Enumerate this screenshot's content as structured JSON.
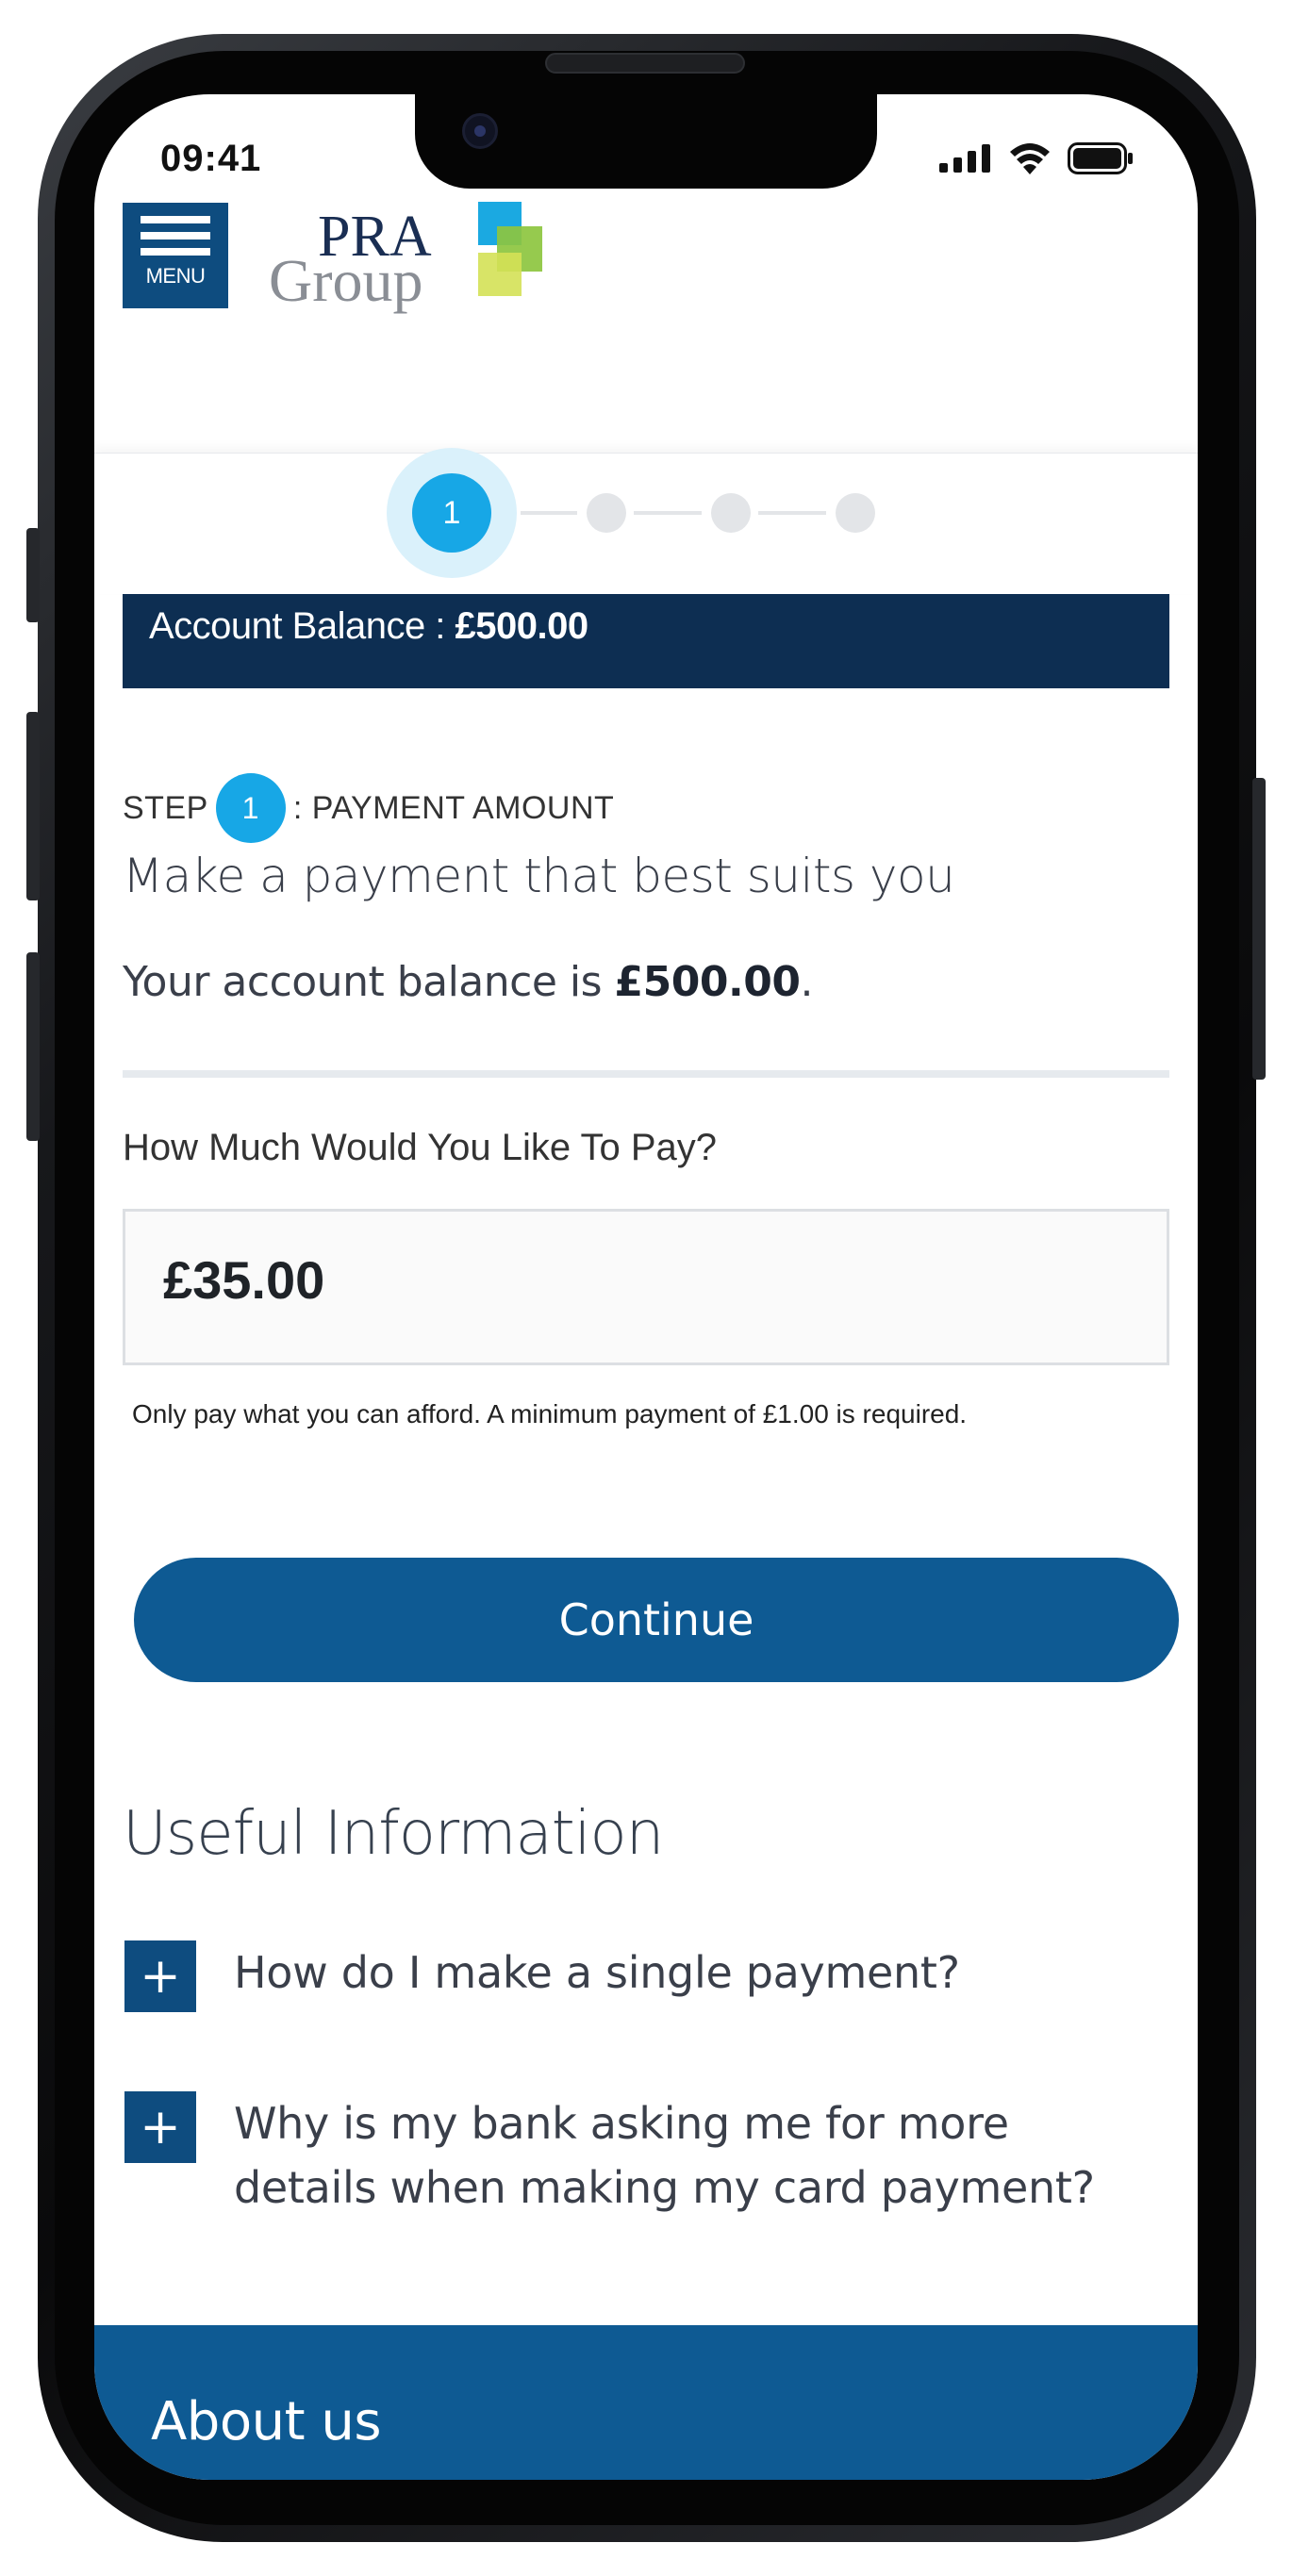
{
  "status_bar": {
    "time": "09:41",
    "signal_icon": "cellular-signal-icon",
    "wifi_icon": "wifi-icon",
    "battery_icon": "battery-icon"
  },
  "header": {
    "menu_label": "MENU",
    "logo_line1": "PRA",
    "logo_line2": "Group",
    "logo_colors": [
      "#1ba9e1",
      "#8dc63f",
      "#c9da4a"
    ]
  },
  "stepper": {
    "active_step": "1",
    "total_steps": 4
  },
  "banner": {
    "label": "Account Balance : ",
    "value": "£500.00"
  },
  "step_heading": {
    "prefix": "STEP",
    "number": "1",
    "suffix": ": PAYMENT AMOUNT"
  },
  "headline": "Make a payment that best suits you",
  "balance_sentence": {
    "prefix": "Your account balance is ",
    "value": "£500.00",
    "suffix": "."
  },
  "amount": {
    "question": "How Much Would You Like To Pay?",
    "value": "£35.00",
    "hint": "Only pay what you can afford. A minimum payment of £1.00 is required."
  },
  "continue_label": "Continue",
  "useful_info": {
    "title": "Useful Information",
    "items": [
      "How do I make a single payment?",
      "Why is my bank asking me for more details when making my card payment?"
    ]
  },
  "footer": {
    "title": "About us"
  },
  "colors": {
    "primary": "#0e5a93",
    "navy": "#0d2e52",
    "accent": "#17a7e6"
  }
}
